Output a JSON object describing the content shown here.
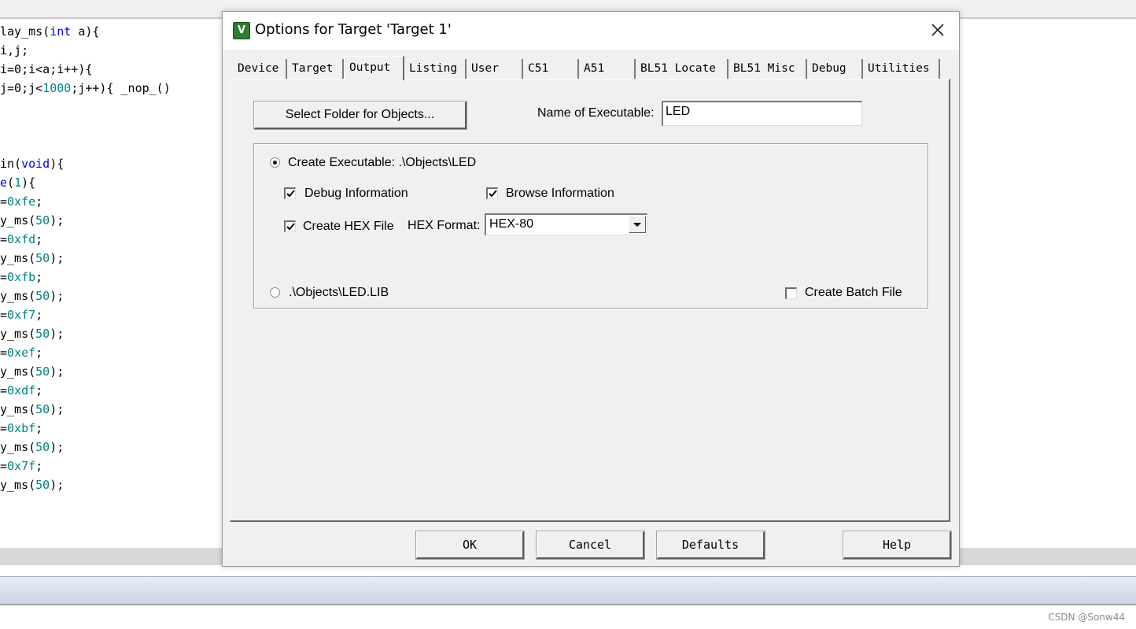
{
  "editor": {
    "lines": [
      [
        {
          "t": "lay_ms("
        },
        {
          "t": "int",
          "c": "kw"
        },
        {
          "t": " a){"
        }
      ],
      [
        {
          "t": "i,j;"
        }
      ],
      [
        {
          "t": "i=0;i<a;i++){"
        }
      ],
      [
        {
          "t": "j=0;j<"
        },
        {
          "t": "1000",
          "c": "num"
        },
        {
          "t": ";j++){ _nop_()"
        }
      ],
      [],
      [],
      [],
      [
        {
          "t": "in("
        },
        {
          "t": "void",
          "c": "kw"
        },
        {
          "t": "){"
        }
      ],
      [
        {
          "t": "e",
          "c": "kw"
        },
        {
          "t": "("
        },
        {
          "t": "1",
          "c": "num"
        },
        {
          "t": "){"
        }
      ],
      [
        {
          "t": "="
        },
        {
          "t": "0xfe",
          "c": "num"
        },
        {
          "t": ";"
        }
      ],
      [
        {
          "t": "y_ms("
        },
        {
          "t": "50",
          "c": "num"
        },
        {
          "t": ");"
        }
      ],
      [
        {
          "t": "="
        },
        {
          "t": "0xfd",
          "c": "num"
        },
        {
          "t": ";"
        }
      ],
      [
        {
          "t": "y_ms("
        },
        {
          "t": "50",
          "c": "num"
        },
        {
          "t": ");"
        }
      ],
      [
        {
          "t": "="
        },
        {
          "t": "0xfb",
          "c": "num"
        },
        {
          "t": ";"
        }
      ],
      [
        {
          "t": "y_ms("
        },
        {
          "t": "50",
          "c": "num"
        },
        {
          "t": ");"
        }
      ],
      [
        {
          "t": "="
        },
        {
          "t": "0xf7",
          "c": "num"
        },
        {
          "t": ";"
        }
      ],
      [
        {
          "t": "y_ms("
        },
        {
          "t": "50",
          "c": "num"
        },
        {
          "t": ");"
        }
      ],
      [
        {
          "t": "="
        },
        {
          "t": "0xef",
          "c": "num"
        },
        {
          "t": ";"
        }
      ],
      [
        {
          "t": "y_ms("
        },
        {
          "t": "50",
          "c": "num"
        },
        {
          "t": ");"
        }
      ],
      [
        {
          "t": "="
        },
        {
          "t": "0xdf",
          "c": "num"
        },
        {
          "t": ";"
        }
      ],
      [
        {
          "t": "y_ms("
        },
        {
          "t": "50",
          "c": "num"
        },
        {
          "t": ");"
        }
      ],
      [
        {
          "t": "="
        },
        {
          "t": "0xbf",
          "c": "num"
        },
        {
          "t": ";"
        }
      ],
      [
        {
          "t": "y_ms("
        },
        {
          "t": "50",
          "c": "num"
        },
        {
          "t": ");"
        }
      ],
      [
        {
          "t": "="
        },
        {
          "t": "0x7f",
          "c": "num"
        },
        {
          "t": ";"
        }
      ],
      [
        {
          "t": "y_ms("
        },
        {
          "t": "50",
          "c": "num"
        },
        {
          "t": ");"
        }
      ]
    ],
    "colors": {
      "keyword": "#0000ff",
      "number": "#008080",
      "text": "#000000"
    }
  },
  "dialog": {
    "title": "Options for Target 'Target 1'",
    "icon_glyph": "V",
    "tabs": [
      {
        "label": "Device",
        "active": false
      },
      {
        "label": "Target",
        "active": false
      },
      {
        "label": "Output",
        "active": true
      },
      {
        "label": "Listing",
        "active": false
      },
      {
        "label": "User",
        "active": false
      },
      {
        "label": "C51",
        "active": false
      },
      {
        "label": "A51",
        "active": false
      },
      {
        "label": "BL51 Locate",
        "active": false
      },
      {
        "label": "BL51 Misc",
        "active": false
      },
      {
        "label": "Debug",
        "active": false
      },
      {
        "label": "Utilities",
        "active": false
      }
    ],
    "output": {
      "select_folder_label": "Select Folder for Objects...",
      "name_of_executable_label": "Name of Executable:",
      "name_of_executable_value": "LED",
      "create_executable_label": "Create Executable:  .\\Objects\\LED",
      "create_executable_selected": true,
      "debug_info_label": "Debug Information",
      "debug_info_checked": true,
      "browse_info_label": "Browse Information",
      "browse_info_checked": true,
      "create_hex_label": "Create HEX File",
      "create_hex_checked": true,
      "hex_format_label": "HEX Format:",
      "hex_format_value": "HEX-80",
      "library_label": ".\\Objects\\LED.LIB",
      "library_selected": false,
      "create_batch_label": "Create Batch File",
      "create_batch_checked": false
    },
    "buttons": {
      "ok": "OK",
      "cancel": "Cancel",
      "defaults": "Defaults",
      "help": "Help"
    }
  },
  "watermark": "CSDN @Sonw44"
}
